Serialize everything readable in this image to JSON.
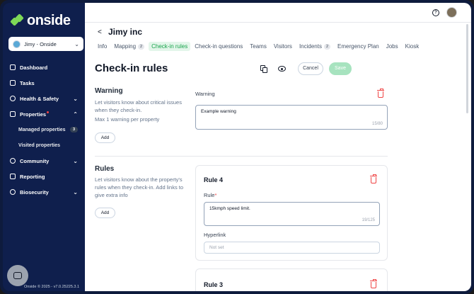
{
  "sidebar": {
    "logo": "onside",
    "account": "Jimy - Onside",
    "items": [
      {
        "label": "Dashboard"
      },
      {
        "label": "Tasks"
      },
      {
        "label": "Health & Safety"
      },
      {
        "label": "Properties"
      },
      {
        "label": "Managed properties",
        "badge": "3"
      },
      {
        "label": "Visited properties"
      },
      {
        "label": "Community"
      },
      {
        "label": "Reporting"
      },
      {
        "label": "Biosecurity"
      }
    ],
    "version": "Onside © 2025 - v7.0.25225.3.1"
  },
  "header": {
    "back": "<",
    "company": "Jimy inc",
    "tabs": [
      {
        "label": "Info"
      },
      {
        "label": "Mapping",
        "count": "2"
      },
      {
        "label": "Check-in rules"
      },
      {
        "label": "Check-in questions"
      },
      {
        "label": "Teams"
      },
      {
        "label": "Visitors"
      },
      {
        "label": "Incidents",
        "count": "2"
      },
      {
        "label": "Emergency Plan"
      },
      {
        "label": "Jobs"
      },
      {
        "label": "Kiosk"
      }
    ]
  },
  "page": {
    "title": "Check-in rules",
    "cancel": "Cancel",
    "save": "Save"
  },
  "warning": {
    "title": "Warning",
    "desc": "Let visitors know about critical issues when they check-in.",
    "limit": "Max 1 warning per property",
    "add": "Add",
    "field_label": "Warning",
    "value": "Example warning",
    "count": "15/80"
  },
  "rules": {
    "title": "Rules",
    "desc": "Let visitors know about the property's rules when they check-in. Add links to give extra info",
    "add": "Add",
    "cards": [
      {
        "title": "Rule 4",
        "rule_label": "Rule",
        "req": "*",
        "rule_value": "15kmph speed limit.",
        "count": "19/125",
        "hyperlink_label": "Hyperlink",
        "hyperlink_placeholder": "Not set"
      },
      {
        "title": "Rule 3"
      }
    ]
  },
  "icons": {
    "help": "?",
    "accent": "#16a34a",
    "danger": "#ef4444"
  }
}
